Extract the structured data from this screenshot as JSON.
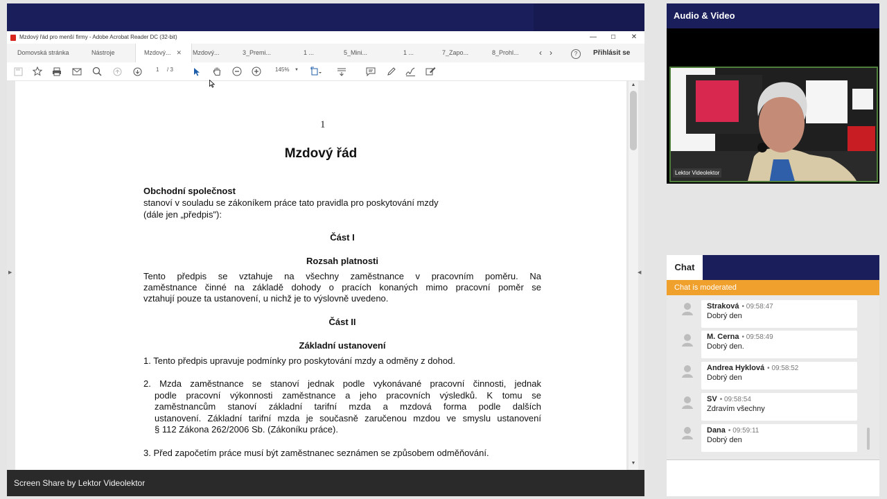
{
  "screen_share": {
    "footer_label": "Screen Share by Lektor Videolektor"
  },
  "acrobat": {
    "window_title": "Mzdový řád pro menší firmy - Adobe Acrobat Reader DC (32-bit)",
    "window_buttons": [
      "—",
      "☐",
      "✕"
    ],
    "tabs": [
      {
        "label": "Domovská stránka"
      },
      {
        "label": "Nástroje"
      },
      {
        "label": "Mzdový...",
        "active": true,
        "close": "✕"
      },
      {
        "label": "Mzdový..."
      },
      {
        "label": "3_Premi..."
      },
      {
        "label": "1 ..."
      },
      {
        "label": "5_Mini..."
      },
      {
        "label": "1 ..."
      },
      {
        "label": "7_Zapo..."
      },
      {
        "label": "8_Prohl..."
      }
    ],
    "tab_nav": {
      "prev": "‹",
      "next": "›"
    },
    "help": "?",
    "sign_in": "Přihlásit se",
    "toolbar": {
      "page_current": "1",
      "page_total": "/ 3",
      "zoom": "145%",
      "icons": [
        "save-icon",
        "star-icon",
        "print-icon",
        "email-icon",
        "zoom-search-icon",
        "prev-page-icon",
        "next-page-icon",
        "select-cursor-icon",
        "hand-icon",
        "zoom-out-icon",
        "zoom-in-icon",
        "fit-page-icon",
        "scroll-mode-icon",
        "comment-icon",
        "highlight-icon",
        "sign-icon",
        "more-tools-icon"
      ]
    },
    "document": {
      "page_number": "1",
      "title": "Mzdový řád",
      "company": "Obchodní společnost",
      "intro_line1": "stanoví v souladu se zákoníkem práce tato pravidla pro poskytování mzdy",
      "intro_line2": "(dále jen „předpis\"):",
      "part1": "Část I",
      "part1_heading": "Rozsah platnosti",
      "part1_text": [
        "Tento předpis se vztahuje na všechny zaměstnance v pracovním poměru. Na",
        "zaměstnance činné na základě dohody o pracích konaných mimo pracovní poměr se",
        "vztahují pouze ta ustanovení, u nichž je to výslovně uvedeno."
      ],
      "part2": "Část II",
      "part2_heading": "Základní ustanovení",
      "item1": "1. Tento předpis upravuje podmínky pro poskytování mzdy a odměny z dohod.",
      "item2_first": "2. Mzda zaměstnance se stanoví jednak podle vykonávané pracovní činnosti, jednak",
      "item2_rest": [
        "podle pracovní výkonnosti zaměstnance a jeho pracovních výsledků. K tomu se",
        "zaměstnancům stanoví základní tarifní mzda a mzdová forma podle dalších",
        "ustanovení. Základní tarifní mzda je současně zaručenou mzdou ve smyslu ustanovení",
        "§ 112 Zákona 262/2006 Sb. (Zákoníku práce)."
      ],
      "item3": "3. Před započetím práce musí být zaměstnanec seznámen se způsobem odměňování."
    }
  },
  "audio_video": {
    "title": "Audio & Video",
    "participant_label": "Lektor Videolektor"
  },
  "chat": {
    "tab_label": "Chat",
    "moderated_notice": "Chat is moderated",
    "messages": [
      {
        "name": "Straková",
        "time": "09:58:47",
        "text": "Dobrý den"
      },
      {
        "name": "M. Cerna",
        "time": "09:58:49",
        "text": "Dobrý den."
      },
      {
        "name": "Andrea Hyklová",
        "time": "09:58:52",
        "text": "Dobrý den"
      },
      {
        "name": "SV",
        "time": "09:58:54",
        "text": "Zdravím všechny"
      },
      {
        "name": "Dana",
        "time": "09:59:11",
        "text": "Dobrý den"
      }
    ]
  },
  "colors": {
    "header_navy": "#1a1f5c",
    "moderated_orange": "#f0a02d",
    "video_border_green": "#4f7d3b",
    "pdf_red": "#d7261e"
  }
}
